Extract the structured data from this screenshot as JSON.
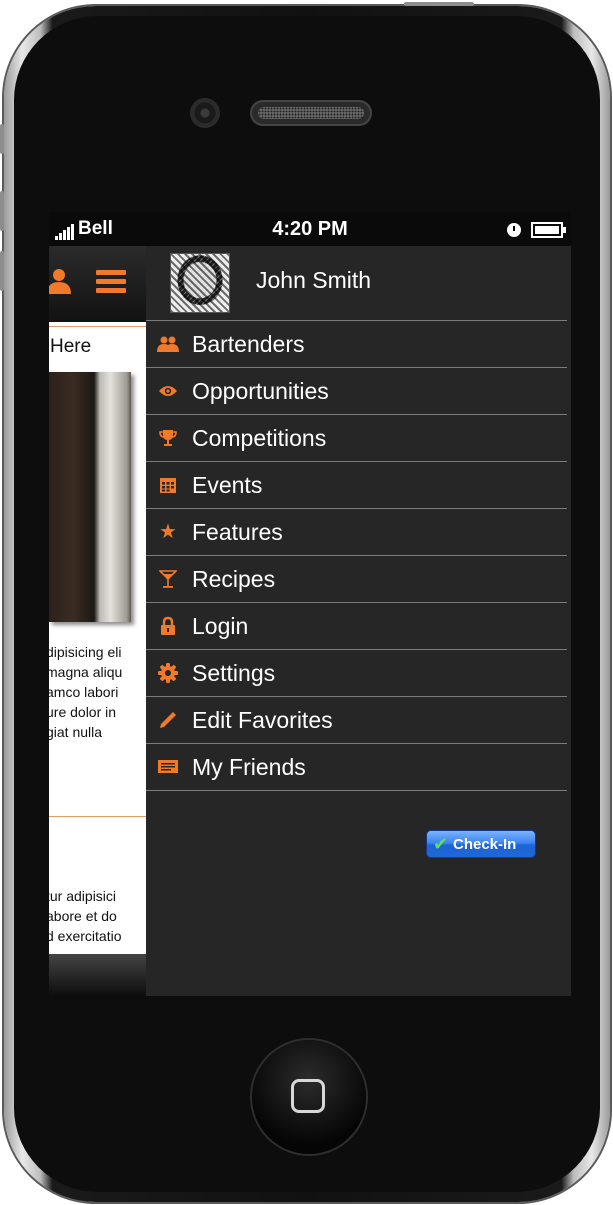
{
  "status_bar": {
    "carrier": "Bell",
    "time": "4:20 PM"
  },
  "background_page": {
    "heading": "Here",
    "paragraph_1": [
      "dipisicing eli",
      "magna aliqu",
      "amco labori",
      "ure dolor in",
      "giat nulla"
    ],
    "paragraph_2": [
      "tur adipisici",
      "abore et do",
      "d exercitatio"
    ]
  },
  "profile": {
    "name": "John Smith"
  },
  "menu": {
    "items": [
      {
        "label": "Bartenders",
        "icon": "people-icon"
      },
      {
        "label": "Opportunities",
        "icon": "eye-icon"
      },
      {
        "label": "Competitions",
        "icon": "trophy-icon"
      },
      {
        "label": "Events",
        "icon": "calendar-icon"
      },
      {
        "label": "Features",
        "icon": "star-icon"
      },
      {
        "label": "Recipes",
        "icon": "cocktail-glass-icon"
      },
      {
        "label": "Login",
        "icon": "lock-icon"
      },
      {
        "label": "Settings",
        "icon": "gear-icon"
      },
      {
        "label": "Edit Favorites",
        "icon": "pencil-icon"
      },
      {
        "label": "My Friends",
        "icon": "friends-card-icon"
      }
    ]
  },
  "checkin": {
    "label": "Check-In"
  },
  "colors": {
    "accent": "#f07a2a",
    "menu_bg": "#262626",
    "button_blue": "#2067d6"
  }
}
